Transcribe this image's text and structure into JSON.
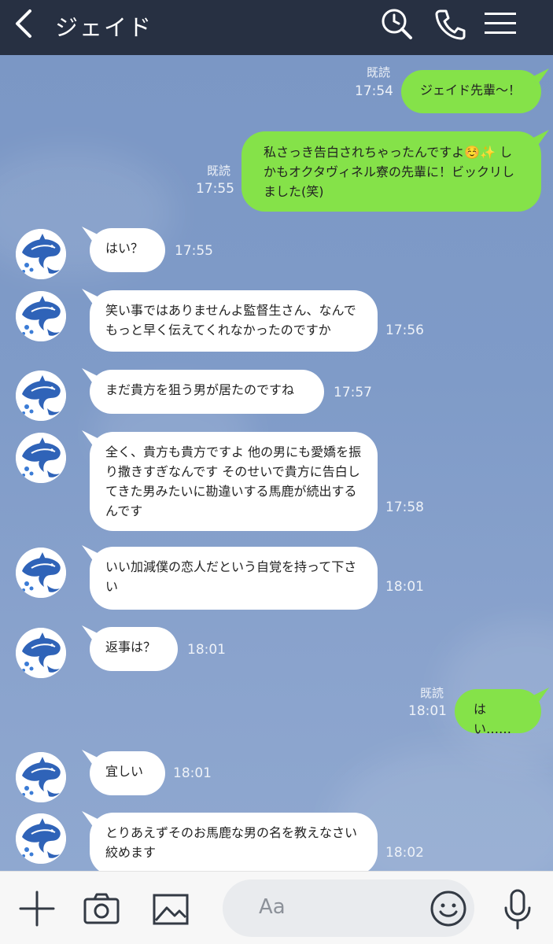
{
  "header": {
    "title": "ジェイド"
  },
  "messages": [
    {
      "side": "out",
      "text": "ジェイド先輩〜！",
      "time": "17:54",
      "read": "既読"
    },
    {
      "side": "out",
      "text": "私さっき告白されちゃったんですよ☺️✨ しかもオクタヴィネル寮の先輩に！ビックリしました(笑)",
      "time": "17:55",
      "read": "既読"
    },
    {
      "side": "in",
      "text": "はい？",
      "time": "17:55"
    },
    {
      "side": "in",
      "text": "笑い事ではありませんよ監督生さん、なんでもっと早く伝えてくれなかったのですか",
      "time": "17:56"
    },
    {
      "side": "in",
      "text": "まだ貴方を狙う男が居たのですね",
      "time": "17:57"
    },
    {
      "side": "in",
      "text": "全く、貴方も貴方ですよ 他の男にも愛嬌を振り撒きすぎなんです そのせいで貴方に告白してきた男みたいに勘違いする馬鹿が続出するんです",
      "time": "17:58"
    },
    {
      "side": "in",
      "text": "いい加減僕の恋人だという自覚を持って下さい",
      "time": "18:01"
    },
    {
      "side": "in",
      "text": "返事は？",
      "time": "18:01"
    },
    {
      "side": "out",
      "text": "はい……",
      "time": "18:01",
      "read": "既読"
    },
    {
      "side": "in",
      "text": "宜しい",
      "time": "18:01"
    },
    {
      "side": "in",
      "text": "とりあえずそのお馬鹿な男の名を教えなさい 絞めます",
      "time": "18:02"
    }
  ],
  "composer": {
    "placeholder": "Aa"
  },
  "icons": {
    "back": "chevron-left-icon",
    "search": "search-icon",
    "call": "phone-icon",
    "menu": "hamburger-menu-icon",
    "add": "plus-icon",
    "camera": "camera-icon",
    "image": "image-icon",
    "emoji": "smile-icon",
    "mic": "microphone-icon",
    "avatar": "dolphin-avatar"
  },
  "colors": {
    "header_bg": "#273042",
    "chat_bg": "#7f9bc7",
    "out_bubble": "#85e249",
    "in_bubble": "#ffffff"
  }
}
